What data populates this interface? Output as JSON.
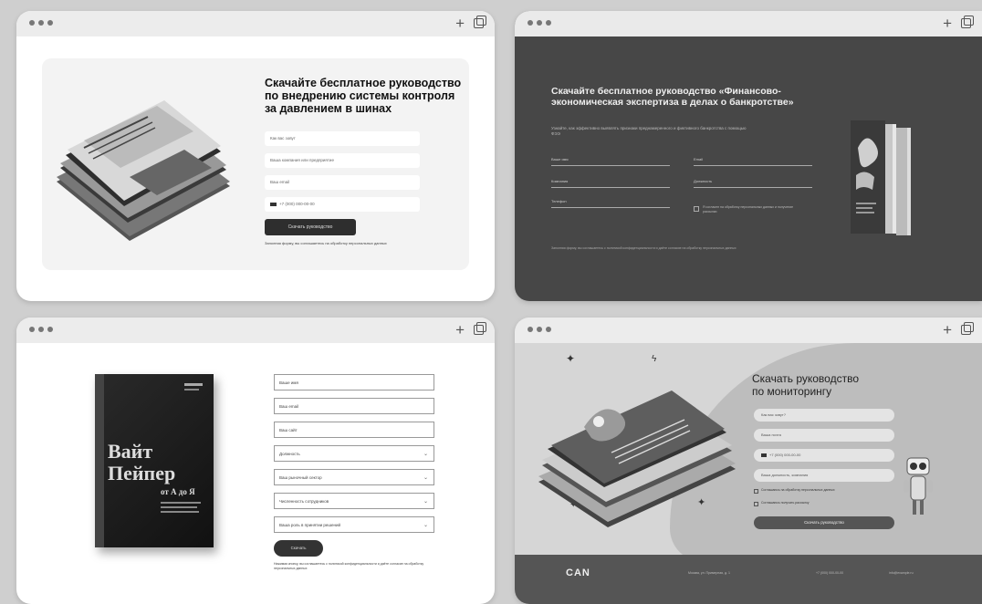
{
  "windows": {
    "w1": {
      "title": "Скачайте бесплатное руководство по внедрению системы контроля за давлением в шинах",
      "fields": [
        "Как вас зовут",
        "Ваша компания или предприятие",
        "Ваш email",
        "+7 (000) 000-00-00"
      ],
      "button": "Скачать руководство",
      "note": "Заполняя форму, вы соглашаетесь на обработку персональных данных"
    },
    "w2": {
      "title": "Скачайте бесплатное руководство «Финансово-экономическая экспертиза в делах о банкротстве»",
      "subtitle": "Узнайте, как эффективно выявлять признаки преднамеренного и фиктивного банкротства с помощью ФЭЭ",
      "fields_left": [
        "Ваше имя",
        "Компания",
        "Телефон"
      ],
      "fields_right": [
        "Email",
        "Должность"
      ],
      "checkbox": "Я согласен на обработку персональных данных и получение рассылки",
      "footer": "Заполняя форму, вы соглашаетесь с политикой конфиденциальности и даёте согласие на обработку персональных данных"
    },
    "w3": {
      "book_title_line1": "Вайт",
      "book_title_line2": "Пейпер",
      "book_subtitle": "от А до Я",
      "fields": [
        {
          "label": "Ваше имя",
          "select": false
        },
        {
          "label": "Ваш email",
          "select": false
        },
        {
          "label": "Ваш сайт",
          "select": false
        },
        {
          "label": "Должность",
          "select": true
        },
        {
          "label": "Ваш рыночный сектор",
          "select": true
        },
        {
          "label": "Численность сотрудников",
          "select": true
        },
        {
          "label": "Ваша роль в принятии решений",
          "select": true
        }
      ],
      "button": "Скачать",
      "note": "Нажимая кнопку, вы соглашаетесь с политикой конфиденциальности и даёте согласие на обработку персональных данных"
    },
    "w4": {
      "title_line1": "Скачать руководство",
      "title_line2": "по мониторингу",
      "fields": [
        "Как вас зовут?",
        "Ваша почта",
        "+7 (000) 000-00-00",
        "Ваша должность, компания"
      ],
      "checkboxes": [
        "Соглашаюсь на обработку персональных данных",
        "Соглашаюсь получать рассылку"
      ],
      "button": "Скачать руководство",
      "logo": "CAN",
      "footer_texts": [
        "Москва, ул. Примерная, д. 1",
        "+7 (000) 000-00-00",
        "info@example.ru"
      ]
    }
  },
  "colors": {
    "dark_panel": "#474747",
    "light_panel": "#f3f3f3",
    "button_dark": "#2e2e2e"
  }
}
